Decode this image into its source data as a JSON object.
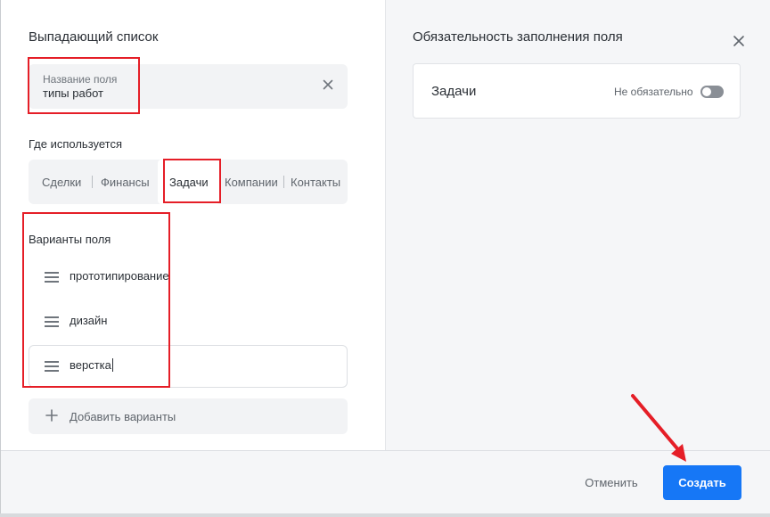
{
  "dialog": {
    "left_title": "Выпадающий список",
    "right_title": "Обязательность заполнения поля"
  },
  "field_name": {
    "label": "Название поля",
    "value": "типы работ"
  },
  "usage": {
    "label": "Где используется",
    "tabs": [
      "Сделки",
      "Финансы",
      "Задачи",
      "Компании",
      "Контакты"
    ],
    "selected": "Задачи"
  },
  "options": {
    "label": "Варианты поля",
    "items": [
      "прототипирование",
      "дизайн",
      "верстка"
    ],
    "add_label": "Добавить варианты"
  },
  "requirement": {
    "entity": "Задачи",
    "state_label": "Не обязательно",
    "required": false
  },
  "footer": {
    "cancel_label": "Отменить",
    "create_label": "Создать"
  },
  "colors": {
    "primary": "#1677f6",
    "annotation": "#e51e27"
  }
}
